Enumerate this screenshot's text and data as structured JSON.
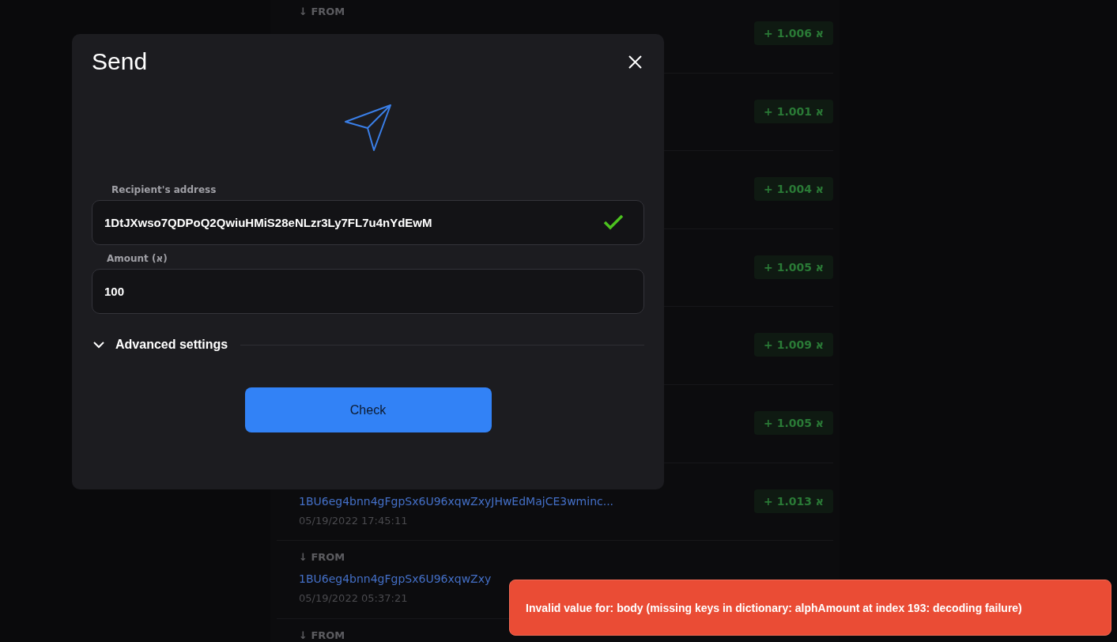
{
  "transactions": [
    {
      "direction": "↓ FROM",
      "amount": "+ 1.006 א"
    },
    {
      "amount": "+ 1.001 א"
    },
    {
      "amount": "+ 1.004 א"
    },
    {
      "amount": "+ 1.005 א"
    },
    {
      "amount": "+ 1.009 א"
    },
    {
      "amount": "+ 1.005 א"
    },
    {
      "address": "1BU6eg4bnn4gFgpSx6U96xqwZxyJHwEdMajCE3wminc...",
      "date": "05/19/2022 17:45:11",
      "amount": "+ 1.013 א"
    },
    {
      "direction": "↓ FROM",
      "address": "1BU6eg4bnn4gFgpSx6U96xqwZxy",
      "date": "05/19/2022 05:37:21"
    },
    {
      "direction": "↓ FROM"
    }
  ],
  "modal": {
    "title": "Send",
    "recipient": {
      "label": "Recipient's address",
      "value": "1DtJXwso7QDPoQ2QwiuHMiS28eNLzr3Ly7FL7u4nYdEwM",
      "valid": true
    },
    "amount": {
      "label": "Amount (א)",
      "value": "100"
    },
    "advanced": {
      "label": "Advanced settings",
      "expanded": false
    },
    "button": "Check"
  },
  "toast": {
    "message": "Invalid value for: body (missing keys in dictionary: alphAmount at index 193: decoding failure)"
  }
}
